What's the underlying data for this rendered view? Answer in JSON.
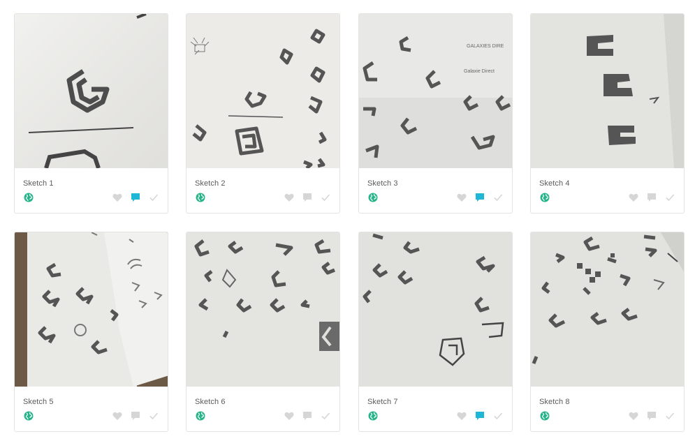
{
  "cards": [
    {
      "title": "Sketch 1",
      "commented": true
    },
    {
      "title": "Sketch 2",
      "commented": false
    },
    {
      "title": "Sketch 3",
      "commented": true
    },
    {
      "title": "Sketch 4",
      "commented": false
    },
    {
      "title": "Sketch 5",
      "commented": false
    },
    {
      "title": "Sketch 6",
      "commented": false
    },
    {
      "title": "Sketch 7",
      "commented": true
    },
    {
      "title": "Sketch 8",
      "commented": false
    }
  ],
  "sketch_notes": {
    "line1": "GALAXIES DIRE",
    "line2": "Galaxie Direct"
  },
  "colors": {
    "globe": "#27b48a",
    "comment_active": "#1fb7d6",
    "icon_inactive": "#d6d6d6",
    "paper": "#ececea",
    "pencil": "#5a5a5a"
  },
  "icons": {
    "visibility": "globe-icon",
    "like": "heart-icon",
    "comment": "comment-icon",
    "approve": "check-icon"
  }
}
